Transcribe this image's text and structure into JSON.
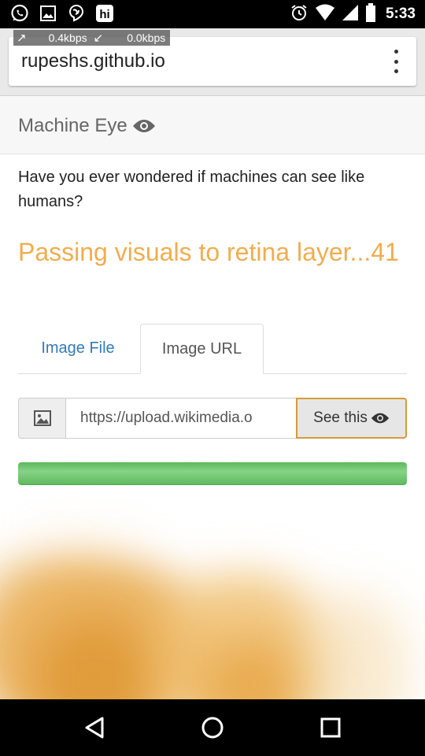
{
  "status_bar": {
    "time": "5:33",
    "left_icons": [
      "whatsapp-icon",
      "gallery-icon",
      "hangouts-icon",
      "hike-icon"
    ],
    "right_icons": [
      "alarm-icon",
      "wifi-icon",
      "signal-icon",
      "battery-icon"
    ]
  },
  "browser": {
    "url": "rupeshs.github.io",
    "net_up": "0.4kbps",
    "net_down": "0.0kbps"
  },
  "navbar": {
    "brand": "Machine Eye"
  },
  "main": {
    "intro": "Have you ever wondered if machines can see like humans?",
    "status": "Passing visuals to retina layer...41",
    "tabs": [
      {
        "label": "Image File",
        "active": false
      },
      {
        "label": "Image URL",
        "active": true
      }
    ],
    "url_input_value": "https://upload.wikimedia.o",
    "see_button": "See this",
    "progress_percent": 100,
    "colors": {
      "status": "#f0ad4e",
      "link": "#337ab7",
      "progress": "#5cb85c",
      "button_border": "#d59a3c"
    }
  }
}
